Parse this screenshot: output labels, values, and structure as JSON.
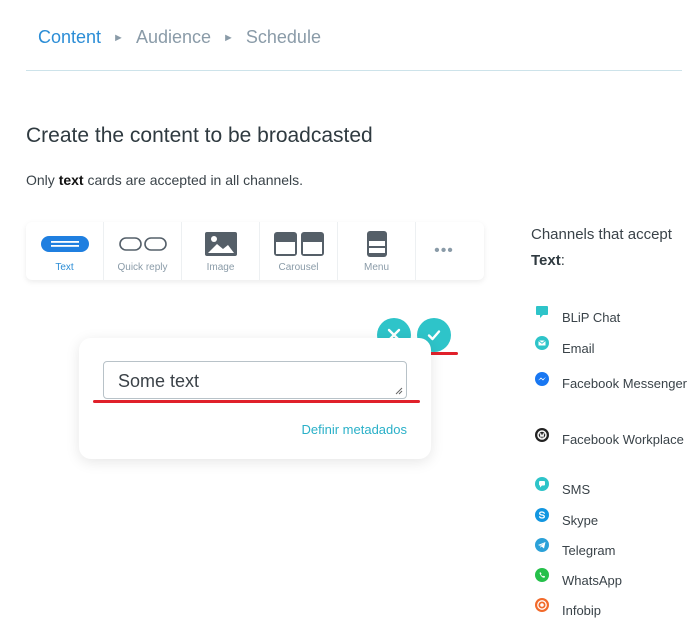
{
  "breadcrumb": {
    "step1": "Content",
    "step2": "Audience",
    "step3": "Schedule",
    "separator": "►"
  },
  "header": {
    "title": "Create the content to be broadcasted",
    "subtitle_prefix": "Only ",
    "subtitle_bold": "text",
    "subtitle_suffix": " cards are accepted in all channels."
  },
  "toolbar": {
    "items": [
      {
        "label": "Text",
        "icon": "text-icon",
        "active": true
      },
      {
        "label": "Quick reply",
        "icon": "quick-reply-icon"
      },
      {
        "label": "Image",
        "icon": "image-icon"
      },
      {
        "label": "Carousel",
        "icon": "carousel-icon"
      },
      {
        "label": "Menu",
        "icon": "menu-icon"
      }
    ],
    "more": "•••"
  },
  "editor": {
    "value": "Some text",
    "meta_link": "Definir metadados"
  },
  "channels": {
    "heading_prefix": "Channels that accept ",
    "heading_bold": "Text",
    "heading_suffix": ":",
    "items": [
      {
        "name": "BLiP Chat",
        "icon": "blip-chat-icon",
        "color": "#2ec4c9"
      },
      {
        "name": "Email",
        "icon": "email-icon",
        "color": "#2ec4c9"
      },
      {
        "name": "Facebook Messenger",
        "icon": "messenger-icon",
        "color": "#1877f2"
      },
      {
        "name": "Facebook Workplace",
        "icon": "workplace-icon",
        "color": "#222222"
      },
      {
        "name": "SMS",
        "icon": "sms-icon",
        "color": "#2ec4c9"
      },
      {
        "name": "Skype",
        "icon": "skype-icon",
        "color": "#1296e0"
      },
      {
        "name": "Telegram",
        "icon": "telegram-icon",
        "color": "#2ba1d8"
      },
      {
        "name": "WhatsApp",
        "icon": "whatsapp-icon",
        "color": "#25c04a"
      },
      {
        "name": "Infobip",
        "icon": "infobip-icon",
        "color": "#f26a2b"
      }
    ]
  },
  "colors": {
    "accent": "#2b8dd6",
    "teal": "#2ec4c9",
    "highlight": "#e0202a"
  }
}
